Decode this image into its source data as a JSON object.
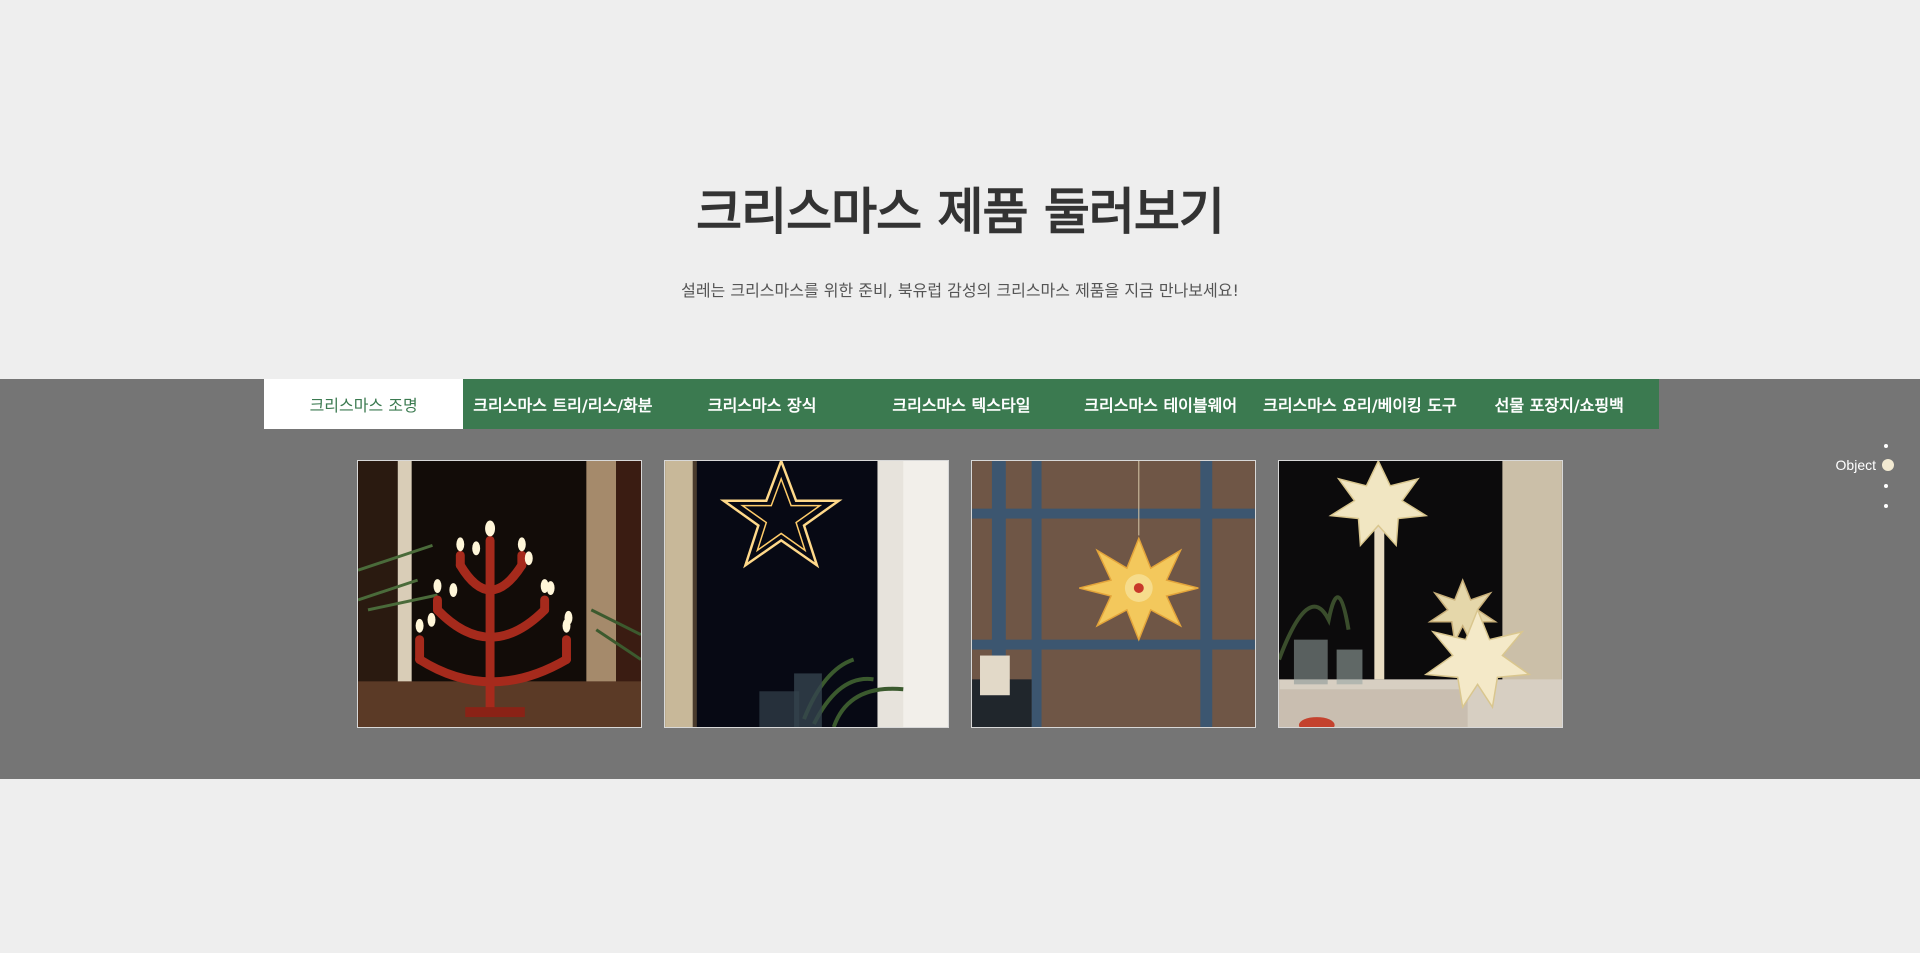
{
  "hero": {
    "title": "크리스마스 제품 둘러보기",
    "subtitle": "설레는 크리스마스를 위한 준비, 북유럽 감성의 크리스마스 제품을 지금 만나보세요!"
  },
  "tabs": [
    {
      "label": "크리스마스 조명",
      "active": true
    },
    {
      "label": "크리스마스 트리/리스/화분",
      "active": false
    },
    {
      "label": "크리스마스 장식",
      "active": false
    },
    {
      "label": "크리스마스 텍스타일",
      "active": false
    },
    {
      "label": "크리스마스 테이블웨어",
      "active": false
    },
    {
      "label": "크리스마스 요리/베이킹 도구",
      "active": false
    },
    {
      "label": "선물 포장지/쇼핑백",
      "active": false
    }
  ],
  "products": [
    {
      "icon": "candelabra-image"
    },
    {
      "icon": "star-light-image"
    },
    {
      "icon": "paper-star-lamp-image"
    },
    {
      "icon": "paper-star-lamps-image"
    }
  ],
  "pager": {
    "label": "Object",
    "count": 4,
    "active_index": 1
  },
  "colors": {
    "page_bg": "#eeeeee",
    "band_bg": "#757575",
    "tab_green": "#3b7a50",
    "title_text": "#333333"
  }
}
